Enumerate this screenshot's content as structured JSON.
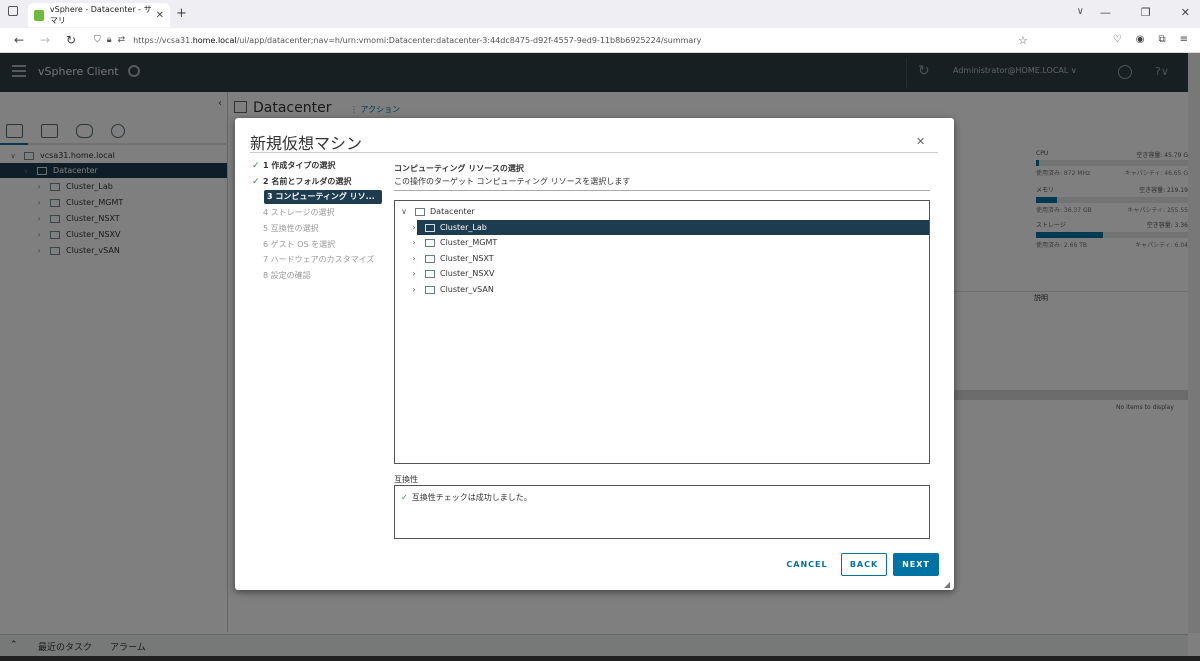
{
  "browser": {
    "tab_title": "vSphere - Datacenter - サマリ",
    "url_prefix": "https://vcsa31.",
    "url_host": "home.local",
    "url_rest": "/ui/app/datacenter;nav=h/urn:vmomi:Datacenter:datacenter-3:44dc8475-d92f-4557-9ed9-11b8b6925224/summary"
  },
  "header": {
    "app_title": "vSphere Client",
    "user": "Administrator@HOME.LOCAL ∨"
  },
  "inventory": {
    "items": [
      {
        "label": "vcsa31.home.local",
        "depth": 0,
        "expanded": true
      },
      {
        "label": "Datacenter",
        "depth": 1,
        "expanded": true,
        "selected": true
      },
      {
        "label": "Cluster_Lab",
        "depth": 2
      },
      {
        "label": "Cluster_MGMT",
        "depth": 2
      },
      {
        "label": "Cluster_NSXT",
        "depth": 2
      },
      {
        "label": "Cluster_NSXV",
        "depth": 2
      },
      {
        "label": "Cluster_vSAN",
        "depth": 2
      }
    ]
  },
  "page": {
    "title": "Datacenter",
    "actions": "アクション"
  },
  "resources": [
    {
      "name": "CPU",
      "free": "空き容量: 45.79 G",
      "used": "使用済み: 872 MHz",
      "capacity": "キャパシティ: 46.65 G",
      "fill": 0.02
    },
    {
      "name": "メモリ",
      "free": "空き容量: 219.19",
      "used": "使用済み: 36.37 GB",
      "capacity": "キャパシティ: 255.55",
      "fill": 0.14
    },
    {
      "name": "ストレージ",
      "free": "空き容量: 3.36",
      "used": "使用済み: 2.66 TB",
      "capacity": "キャパシティ: 6.04",
      "fill": 0.44
    }
  ],
  "table": {
    "desc_header": "説明",
    "empty": "No items to display"
  },
  "bottom": {
    "recent_tasks": "最近のタスク",
    "alarms": "アラーム"
  },
  "modal": {
    "title": "新規仮想マシン",
    "steps": [
      {
        "label": "1 作成タイプの選択",
        "state": "done"
      },
      {
        "label": "2 名前とフォルダの選択",
        "state": "done"
      },
      {
        "label": "3 コンピューティング リソ...",
        "state": "current"
      },
      {
        "label": "4 ストレージの選択",
        "state": "pending"
      },
      {
        "label": "5 互換性の選択",
        "state": "pending"
      },
      {
        "label": "6 ゲスト OS を選択",
        "state": "pending"
      },
      {
        "label": "7 ハードウェアのカスタマイズ",
        "state": "pending"
      },
      {
        "label": "8 設定の確認",
        "state": "pending"
      }
    ],
    "section_title": "コンピューティング リソースの選択",
    "section_subtitle": "この操作のターゲット コンピューティング リソースを選択します",
    "tree": [
      {
        "label": "Datacenter",
        "depth": 0,
        "expanded": true
      },
      {
        "label": "Cluster_Lab",
        "depth": 1,
        "selected": true
      },
      {
        "label": "Cluster_MGMT",
        "depth": 1
      },
      {
        "label": "Cluster_NSXT",
        "depth": 1
      },
      {
        "label": "Cluster_NSXV",
        "depth": 1
      },
      {
        "label": "Cluster_vSAN",
        "depth": 1
      }
    ],
    "compat_label": "互換性",
    "compat_message": "互換性チェックは成功しました。",
    "buttons": {
      "cancel": "CANCEL",
      "back": "BACK",
      "next": "NEXT"
    }
  },
  "colors": {
    "accent": "#0072a3",
    "header_bg": "#313f47",
    "selection": "#1d3c50",
    "success": "#2f8a4b"
  }
}
